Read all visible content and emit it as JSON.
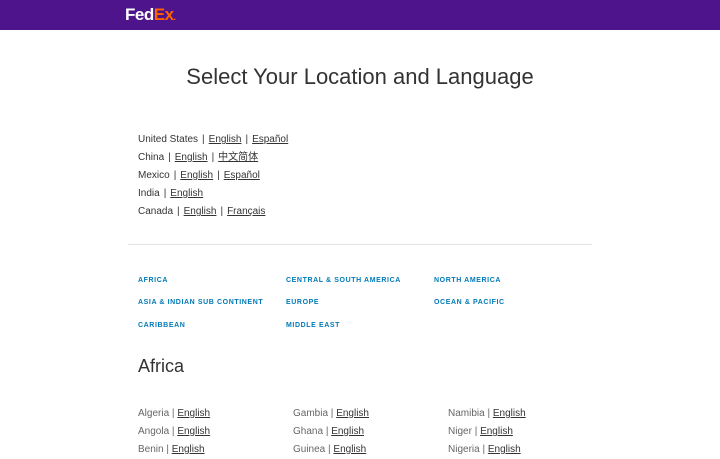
{
  "header": {
    "logo_fed": "Fed",
    "logo_ex": "Ex",
    "logo_dot": "."
  },
  "page_title": "Select Your Location and Language",
  "featured": [
    {
      "country": "United States",
      "langs": [
        "English",
        "Español"
      ]
    },
    {
      "country": "China",
      "langs": [
        "English",
        "中文简体"
      ]
    },
    {
      "country": "Mexico",
      "langs": [
        "English",
        "Español"
      ]
    },
    {
      "country": "India",
      "langs": [
        "English"
      ]
    },
    {
      "country": "Canada",
      "langs": [
        "English",
        "Français"
      ]
    }
  ],
  "regions": {
    "africa": "AFRICA",
    "asia": "ASIA & INDIAN SUB CONTINENT",
    "caribbean": "CARIBBEAN",
    "central_south_america": "CENTRAL & SOUTH AMERICA",
    "europe": "EUROPE",
    "middle_east": "MIDDLE EAST",
    "north_america": "NORTH AMERICA",
    "ocean_pacific": "OCEAN & PACIFIC"
  },
  "africa": {
    "heading": "Africa",
    "columns": [
      [
        {
          "country": "Algeria",
          "lang": "English"
        },
        {
          "country": "Angola",
          "lang": "English"
        },
        {
          "country": "Benin",
          "lang": "English"
        }
      ],
      [
        {
          "country": "Gambia",
          "lang": "English"
        },
        {
          "country": "Ghana",
          "lang": "English"
        },
        {
          "country": "Guinea",
          "lang": "English"
        }
      ],
      [
        {
          "country": "Namibia",
          "lang": "English"
        },
        {
          "country": "Niger",
          "lang": "English"
        },
        {
          "country": "Nigeria",
          "lang": "English"
        }
      ]
    ]
  },
  "separator": "|",
  "colors": {
    "header_bg": "#4d148c",
    "logo_ex": "#ff6200",
    "region_link": "#007ab7"
  }
}
